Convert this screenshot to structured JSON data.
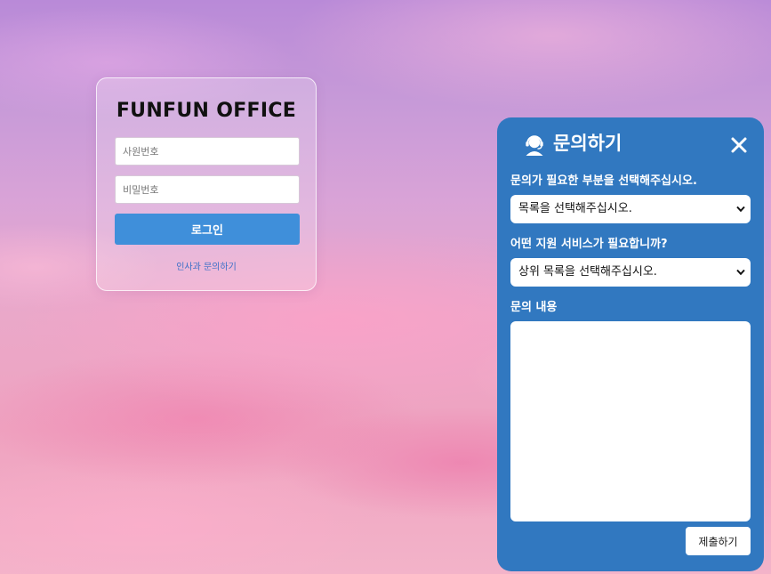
{
  "login": {
    "title": "FUNFUN OFFICE",
    "employee_id_placeholder": "사원번호",
    "password_placeholder": "비밀번호",
    "login_button": "로그인",
    "hr_inquiry_link": "인사과 문의하기"
  },
  "inquiry": {
    "title": "문의하기",
    "header_icon": "headset-icon",
    "close_icon": "close-icon",
    "category_label": "문의가 필요한 부분을 선택해주십시오.",
    "category_selected": "목록을 선택해주십시오.",
    "service_label": "어떤 지원 서비스가 필요합니까?",
    "service_selected": "상위 목록을 선택해주십시오.",
    "content_label": "문의 내용",
    "content_value": "",
    "submit_button": "제출하기"
  },
  "colors": {
    "panel_bg": "#3178c0",
    "login_button_bg": "#3f8fda",
    "link_color": "#3a6fc7"
  }
}
